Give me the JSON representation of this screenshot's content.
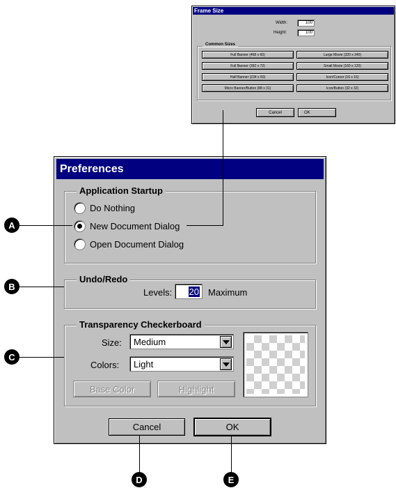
{
  "frame_size": {
    "title": "Frame Size",
    "width_label": "Width:",
    "width_value": "100",
    "height_label": "Height:",
    "height_value": "100",
    "common_sizes_label": "Common Sizes",
    "sizes": [
      "Full Banner (468 x 60)",
      "Large Movie (320 x 240)",
      "Full Banner (392 x 72)",
      "Small Movie (160 x 120)",
      "Half Banner (234 x 60)",
      "Icon/Cursor (16 x 16)",
      "Micro Banner/Button (88 x 31)",
      "Icon/Button (32 x 32)"
    ],
    "cancel": "Cancel",
    "ok": "OK"
  },
  "preferences": {
    "title": "Preferences",
    "startup": {
      "label": "Application Startup",
      "options": [
        "Do Nothing",
        "New Document Dialog",
        "Open Document Dialog"
      ],
      "selected": "New Document Dialog"
    },
    "undo": {
      "label": "Undo/Redo",
      "levels_label": "Levels:",
      "levels_value": "20",
      "suffix": "Maximum"
    },
    "transparency": {
      "label": "Transparency Checkerboard",
      "size_label": "Size:",
      "size_value": "Medium",
      "colors_label": "Colors:",
      "colors_value": "Light",
      "base_color": "Base Color",
      "highlight": "Highlight"
    },
    "cancel": "Cancel",
    "ok": "OK"
  },
  "callouts": [
    "A",
    "B",
    "C",
    "D",
    "E"
  ]
}
